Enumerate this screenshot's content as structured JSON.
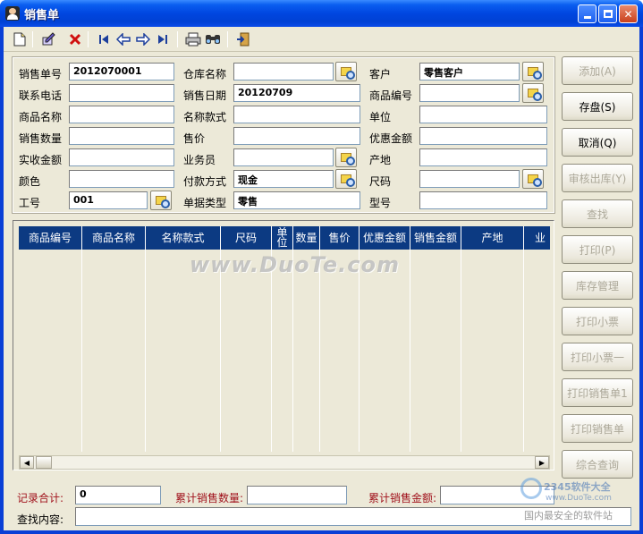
{
  "window": {
    "title": "销售单",
    "minimize": "minimize",
    "maximize": "maximize",
    "close": "✕"
  },
  "toolbar": {
    "icons": [
      "new-icon",
      "edit-icon",
      "delete-icon",
      "first-icon",
      "prev-icon",
      "next-icon",
      "last-icon",
      "print-icon",
      "find-icon",
      "exit-icon"
    ]
  },
  "form": {
    "order_no_label": "销售单号",
    "order_no": "2012070001",
    "warehouse_label": "仓库名称",
    "warehouse": "",
    "customer_label": "客户",
    "customer": "零售客户",
    "phone_label": "联系电话",
    "phone": "",
    "date_label": "销售日期",
    "date": "20120709",
    "product_code_label": "商品编号",
    "product_code": "",
    "product_name_label": "商品名称",
    "product_name": "",
    "style_label": "名称款式",
    "style": "",
    "unit_label": "单位",
    "unit": "",
    "qty_label": "销售数量",
    "qty": "",
    "price_label": "售价",
    "price": "",
    "discount_label": "优惠金额",
    "discount": "",
    "received_label": "实收金额",
    "received": "",
    "salesman_label": "业务员",
    "salesman": "",
    "origin_label": "产地",
    "origin": "",
    "color_label": "颜色",
    "color": "",
    "payment_label": "付款方式",
    "payment": "现金",
    "size_label": "尺码",
    "size": "",
    "staff_no_label": "工号",
    "staff_no": "001",
    "doc_type_label": "单据类型",
    "doc_type": "零售",
    "model_label": "型号",
    "model": ""
  },
  "grid": {
    "columns": [
      "商品编号",
      "商品名称",
      "名称款式",
      "尺码",
      "单\n位",
      "数量",
      "售价",
      "优惠金额",
      "销售金额",
      "产地",
      "业"
    ],
    "watermark": "www.DuoTe.com"
  },
  "side_buttons": [
    {
      "label": "添加(A)",
      "enabled": false
    },
    {
      "label": "存盘(S)",
      "enabled": true
    },
    {
      "label": "取消(Q)",
      "enabled": true
    },
    {
      "label": "审核出库(Y)",
      "enabled": false
    },
    {
      "label": "查找",
      "enabled": false
    },
    {
      "label": "打印(P)",
      "enabled": false
    },
    {
      "label": "库存管理",
      "enabled": false
    },
    {
      "label": "打印小票",
      "enabled": false
    },
    {
      "label": "打印小票一",
      "enabled": false
    },
    {
      "label": "打印销售单1",
      "enabled": false
    },
    {
      "label": "打印销售单",
      "enabled": false
    },
    {
      "label": "综合查询",
      "enabled": false
    }
  ],
  "footer": {
    "record_total_label": "记录合计:",
    "record_total": "0",
    "total_qty_label": "累计销售数量:",
    "total_qty": "",
    "total_amount_label": "累计销售金额:",
    "total_amount": "",
    "search_label": "查找内容:",
    "search_value": ""
  },
  "corner_watermark": {
    "brand": "2345软件大全",
    "url": "www.DuoTe.com",
    "slogan": "国内最安全的软件站"
  },
  "colors": {
    "title_bar": "#0046e0",
    "grid_header": "#0c3a82",
    "client_bg": "#ece9d8",
    "footer_label_red": "#a0111b"
  }
}
